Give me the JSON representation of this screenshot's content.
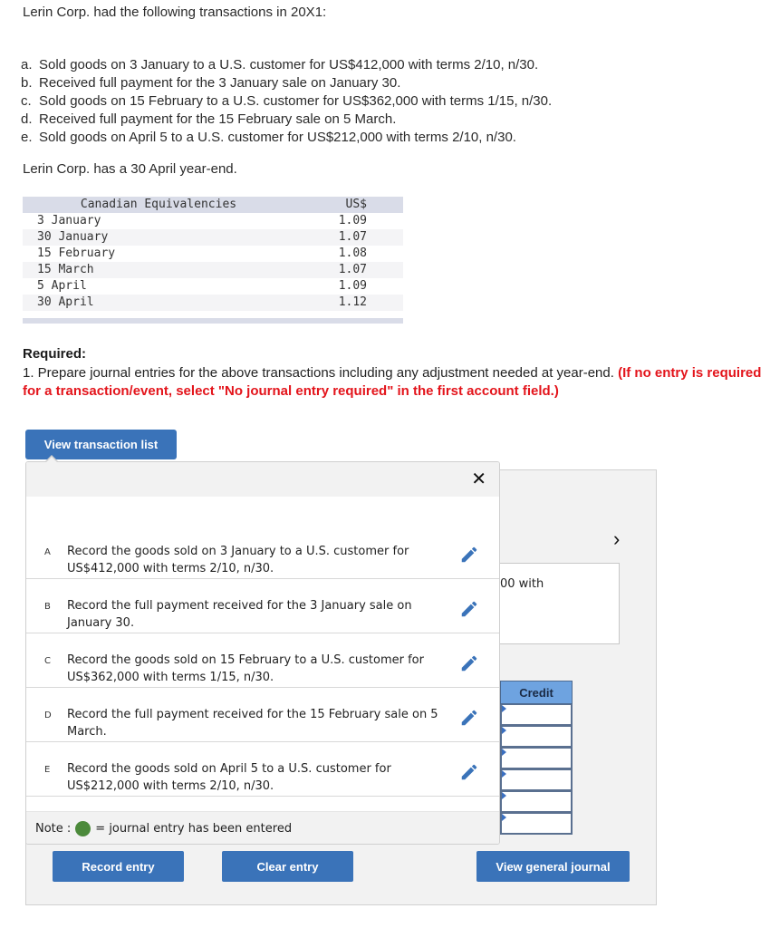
{
  "question": {
    "intro": "Lerin Corp. had the following transactions in 20X1:",
    "transactions": [
      {
        "letter": "a.",
        "text": "Sold goods on 3 January to a U.S. customer for US$412,000 with terms 2/10, n/30."
      },
      {
        "letter": "b.",
        "text": "Received full payment for the 3 January sale on January 30."
      },
      {
        "letter": "c.",
        "text": "Sold goods on 15 February to a U.S. customer for US$362,000 with terms 1/15, n/30."
      },
      {
        "letter": "d.",
        "text": "Received full payment for the 15 February sale on 5 March."
      },
      {
        "letter": "e.",
        "text": "Sold goods on April 5 to a U.S. customer for US$212,000 with terms 2/10, n/30."
      }
    ],
    "year_end": "Lerin Corp. has a 30 April year-end."
  },
  "rates_table": {
    "header": [
      "Canadian Equivalencies",
      "US$"
    ],
    "rows": [
      {
        "date": "3 January",
        "rate": "1.09"
      },
      {
        "date": "30 January",
        "rate": "1.07"
      },
      {
        "date": "15 February",
        "rate": "1.08"
      },
      {
        "date": "15 March",
        "rate": "1.07"
      },
      {
        "date": "5 April",
        "rate": "1.09"
      },
      {
        "date": "30 April",
        "rate": "1.12"
      }
    ]
  },
  "required": {
    "label": "Required:",
    "text": "1. Prepare journal entries for the above transactions including any adjustment needed at year-end. ",
    "instruction": "(If no entry is required for a transaction/event, select \"No journal entry required\" in the first account field.)"
  },
  "workspace": {
    "view_transaction_list_label": "View transaction list",
    "next_arrow": "›",
    "description_fragment": "00 with",
    "credit_header": "Credit",
    "credit_rows": [
      "",
      "",
      "",
      "",
      "",
      ""
    ]
  },
  "popup": {
    "close_label": "✕",
    "entries": [
      {
        "letter": "A",
        "desc": "Record the goods sold on 3 January to a U.S. customer for US$412,000 with terms 2/10, n/30."
      },
      {
        "letter": "B",
        "desc": "Record the full payment received for the 3 January sale on January 30."
      },
      {
        "letter": "C",
        "desc": "Record the goods sold on 15 February to a U.S. customer for US$362,000 with terms 1/15, n/30."
      },
      {
        "letter": "D",
        "desc": "Record the full payment received for the 15 February sale on 5 March."
      },
      {
        "letter": "E",
        "desc": "Record the goods sold on April 5 to a U.S. customer for US$212,000 with terms 2/10, n/30."
      }
    ],
    "note_prefix": "Note :",
    "note_suffix": "= journal entry has been entered"
  },
  "buttons": {
    "record": "Record entry",
    "clear": "Clear entry",
    "view_journal": "View general journal"
  },
  "colors": {
    "accent": "#3a73b9",
    "required_red": "#e3141b",
    "entered_dot": "#4c8a3b",
    "credit_header": "#6ea3e0"
  }
}
